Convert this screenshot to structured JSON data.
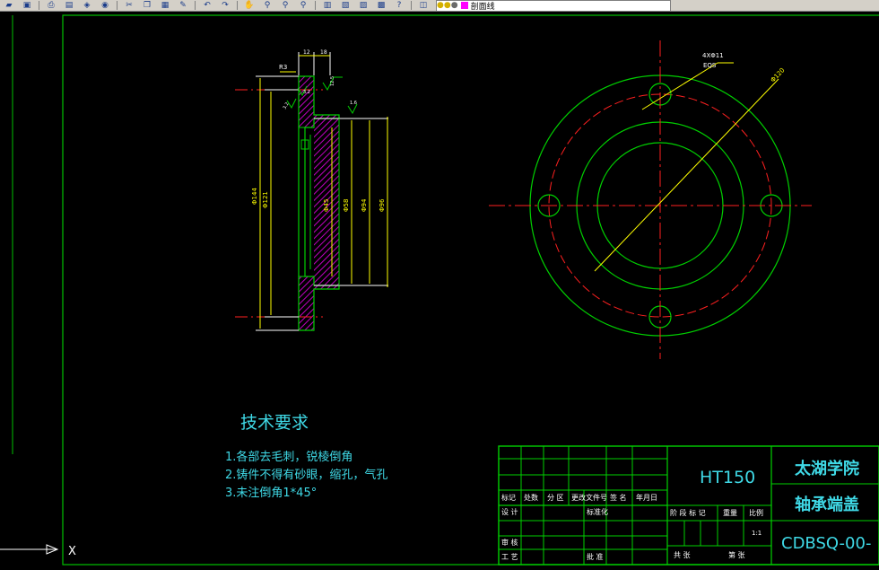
{
  "toolbar": {
    "icons": [
      "folder-open-icon",
      "save-icon",
      "print-icon",
      "preview-icon",
      "publish-icon",
      "plot-icon",
      "cut-icon",
      "copy-icon",
      "paste-icon",
      "match-icon",
      "undo-icon",
      "redo-icon",
      "pan-icon",
      "zoom-realtime-icon",
      "zoom-window-icon",
      "zoom-previous-icon",
      "properties-icon",
      "design-center-icon",
      "tool-palette-icon",
      "calculator-icon",
      "help-icon",
      "layer-manager-icon"
    ],
    "layer_name": "剖面线"
  },
  "drawing": {
    "section_dims": {
      "r": "R3",
      "w12": "12",
      "w18": "18",
      "d144": "Φ144",
      "d121": "Φ121",
      "d45": "Φ45",
      "d58": "Φ58",
      "d94": "Φ94",
      "d96": "Φ96",
      "finish_a": "12.5",
      "finish_b": "3.2",
      "finish_c": "3.2",
      "finish_d": "1.6"
    },
    "plan_dims": {
      "holes": "4XΦ11",
      "eqs": "EQS",
      "diameter": "Φ120"
    },
    "axis_label": "X"
  },
  "tech_requirements": {
    "title": "技术要求",
    "items": [
      "1.各部去毛刺，锐棱倒角",
      "2.铸件不得有砂眼，缩孔，气孔",
      "3.未注倒角1*45°"
    ]
  },
  "title_block": {
    "material": "HT150",
    "school": "太湖学院",
    "part_name": "轴承端盖",
    "drawing_no": "CDBSQ-00-",
    "scale": "1:1",
    "labels": {
      "mark": "标记",
      "count": "处数",
      "zone": "分 区",
      "doc_no": "更改文件号",
      "sign": "签 名",
      "date": "年月日",
      "design": "设 计",
      "standardize": "标准化",
      "stage_mark": "阶 段 标 记",
      "weight": "重量",
      "ratio": "比例",
      "review": "审 核",
      "craft": "工 艺",
      "approve": "批 准",
      "total_sheets": "共 张",
      "sheet_no": "第 张"
    }
  }
}
